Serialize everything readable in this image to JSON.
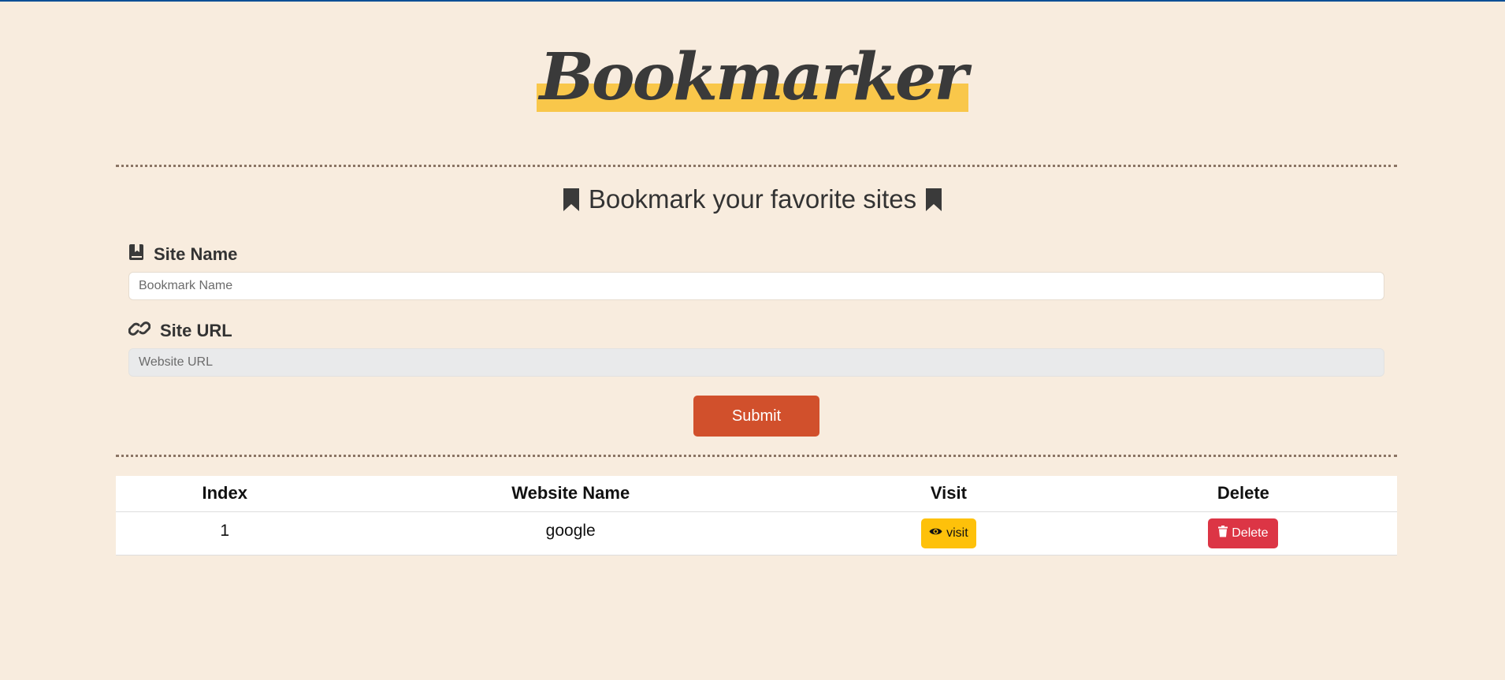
{
  "app": {
    "logo_text": "Bookmarker",
    "accent_color": "#f9c74a"
  },
  "form": {
    "heading": "Bookmark your favorite sites",
    "site_name_label": "Site Name",
    "site_name_placeholder": "Bookmark Name",
    "site_name_value": "",
    "site_url_label": "Site URL",
    "site_url_placeholder": "Website URL",
    "site_url_value": "",
    "submit_label": "Submit",
    "icons": {
      "heading": "bookmark-icon",
      "site_name": "book-bookmark-icon",
      "site_url": "link-icon"
    }
  },
  "table": {
    "headers": [
      "Index",
      "Website Name",
      "Visit",
      "Delete"
    ],
    "rows": [
      {
        "index": "1",
        "name": "google",
        "visit_label": "visit",
        "delete_label": "Delete"
      }
    ],
    "colors": {
      "visit": "#fec10a",
      "delete": "#dc3545",
      "submit": "#d1502c"
    }
  }
}
